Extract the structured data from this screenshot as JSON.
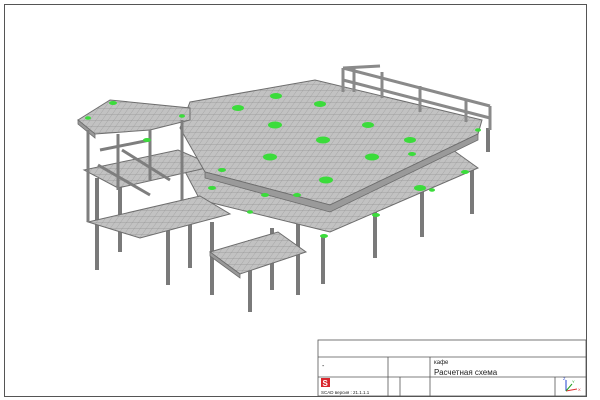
{
  "title_block": {
    "object_name": "кафе",
    "drawing_name": "Расчетная схема",
    "small_mark": "-",
    "software_version": "SCAD версия : 21.1.1.1",
    "logo_letter": "S"
  },
  "axis_indicator": {
    "x": "X",
    "y": "Y",
    "z": "Z"
  },
  "colors": {
    "structure_fill": "#b8b8b8",
    "structure_line": "#6e6e6e",
    "column": "#8e8e8e",
    "support_marker": "#3bdc3b",
    "logo": "#d9272e",
    "axis_x": "#e03030",
    "axis_y": "#20a020",
    "axis_z": "#2040d0"
  },
  "legend_icon": "scad-logo-icon"
}
